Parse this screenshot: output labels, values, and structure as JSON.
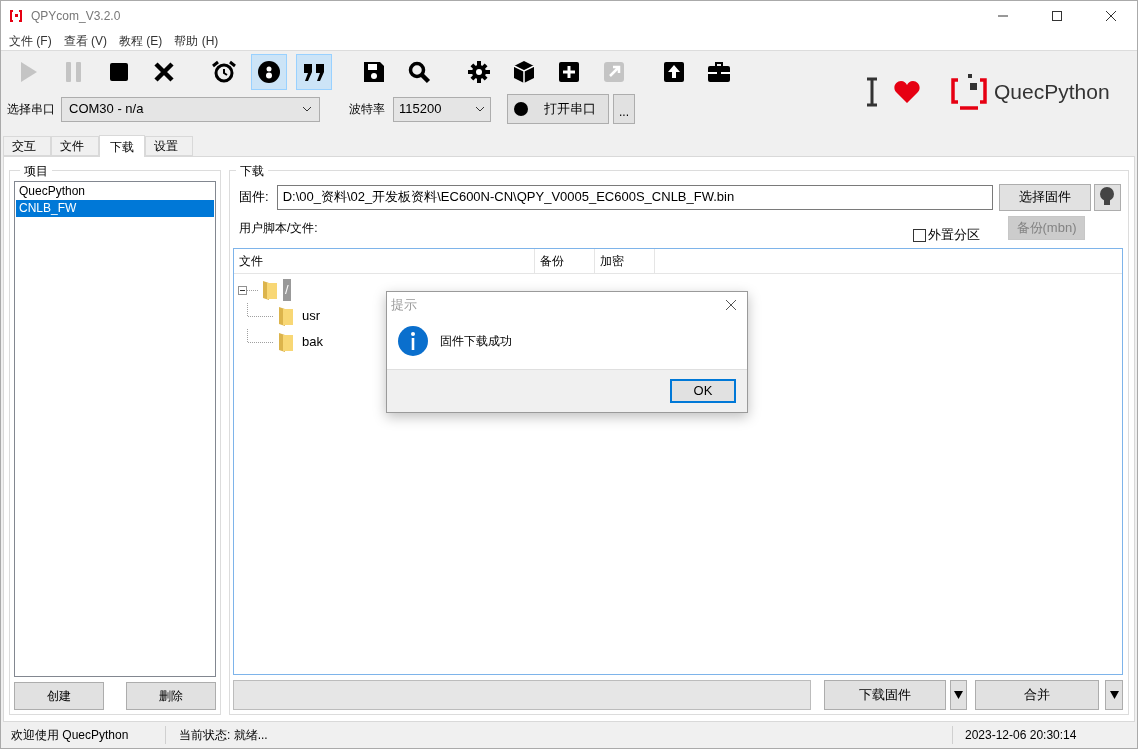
{
  "window": {
    "title": "QPYcom_V3.2.0"
  },
  "menu": [
    "文件 (F)",
    "查看 (V)",
    "教程 (E)",
    "帮助 (H)"
  ],
  "toolbar": {
    "groups": [
      [
        {
          "disabled": true,
          "selected": false
        },
        {
          "disabled": true,
          "selected": false
        },
        {
          "disabled": false,
          "selected": false
        },
        {
          "disabled": false,
          "selected": false
        }
      ],
      [
        {
          "disabled": false,
          "selected": false
        },
        {
          "disabled": false,
          "selected": true
        },
        {
          "disabled": false,
          "selected": true
        }
      ],
      [
        {
          "disabled": false,
          "selected": false
        },
        {
          "disabled": false,
          "selected": false
        }
      ],
      [
        {
          "disabled": false,
          "selected": false
        },
        {
          "disabled": false,
          "selected": false
        },
        {
          "disabled": false,
          "selected": false
        },
        {
          "disabled": true,
          "selected": false
        }
      ],
      [
        {
          "disabled": false,
          "selected": false
        },
        {
          "disabled": false,
          "selected": false
        }
      ]
    ]
  },
  "port": {
    "label": "选择串口",
    "value": "COM30 - n/a"
  },
  "baud": {
    "label": "波特率",
    "value": "115200"
  },
  "open_button": "打开串口",
  "more_button": "...",
  "logo": {
    "text": "QuecPython"
  },
  "tabs": [
    {
      "label": "交互",
      "selected": false
    },
    {
      "label": "文件",
      "selected": false
    },
    {
      "label": "下载",
      "selected": true
    },
    {
      "label": "设置",
      "selected": false
    }
  ],
  "project": {
    "title": "项目",
    "items": [
      {
        "label": "QuecPython",
        "selected": false
      },
      {
        "label": "CNLB_FW",
        "selected": true
      }
    ],
    "buttons": [
      "创建",
      "删除"
    ]
  },
  "download": {
    "title": "下载",
    "firmware_label": "固件:",
    "firmware_path": "D:\\00_资料\\02_开发板资料\\EC600N-CN\\QPY_V0005_EC600S_CNLB_FW.bin",
    "select_button": "选择固件",
    "scripts_label": "用户脚本/文件:",
    "external_partition": {
      "label": "外置分区",
      "checked": false
    },
    "backup_button": {
      "label": "备份(mbn)",
      "disabled": true
    },
    "columns": [
      "文件",
      "备份",
      "加密"
    ],
    "tree": [
      {
        "label": "/",
        "expanded": true,
        "selected": true,
        "children": [
          {
            "label": "usr"
          },
          {
            "label": "bak"
          }
        ]
      }
    ],
    "progress": {
      "level": 0
    },
    "download_button": "下载固件",
    "merge_button": "合并"
  },
  "dialog": {
    "title": "提示",
    "message": "固件下载成功",
    "button": "OK"
  },
  "status_bar": {
    "welcome": "欢迎使用 QuecPython",
    "state": "当前状态: 就绪...",
    "time": "2023-12-06 20:30:14"
  }
}
